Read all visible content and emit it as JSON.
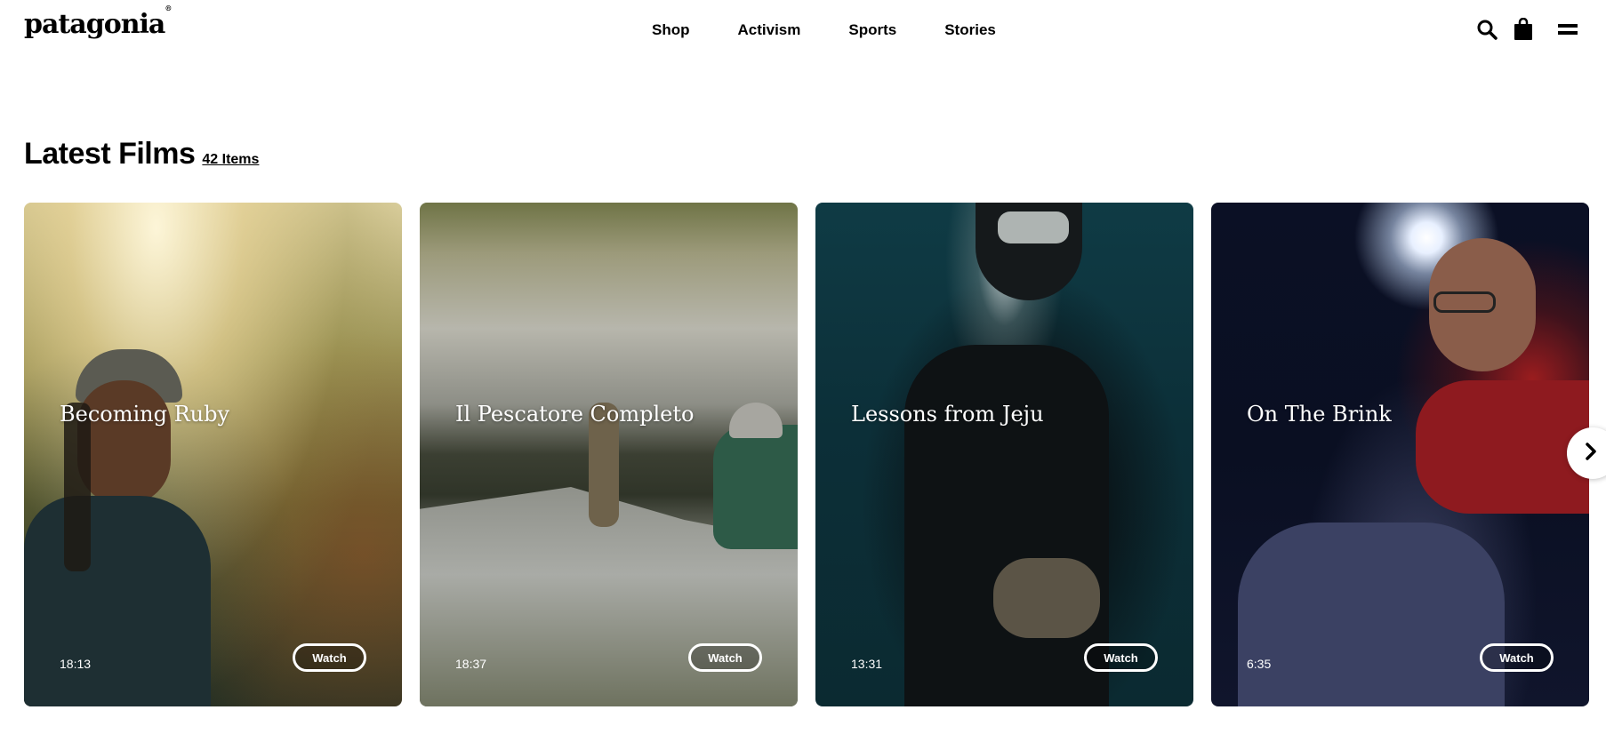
{
  "header": {
    "logo": "patagonia",
    "nav": [
      "Shop",
      "Activism",
      "Sports",
      "Stories"
    ],
    "icons": [
      "search-icon",
      "bag-icon",
      "menu-icon"
    ]
  },
  "section": {
    "title": "Latest Films",
    "count": "42 Items"
  },
  "films": [
    {
      "title": "Becoming Ruby",
      "duration": "18:13",
      "watch": "Watch"
    },
    {
      "title": "Il Pescatore Completo",
      "duration": "18:37",
      "watch": "Watch"
    },
    {
      "title": "Lessons from Jeju",
      "duration": "13:31",
      "watch": "Watch"
    },
    {
      "title": "On The Brink",
      "duration": "6:35",
      "watch": "Watch"
    }
  ],
  "carousel": {
    "next_icon": "chevron-right-icon"
  }
}
